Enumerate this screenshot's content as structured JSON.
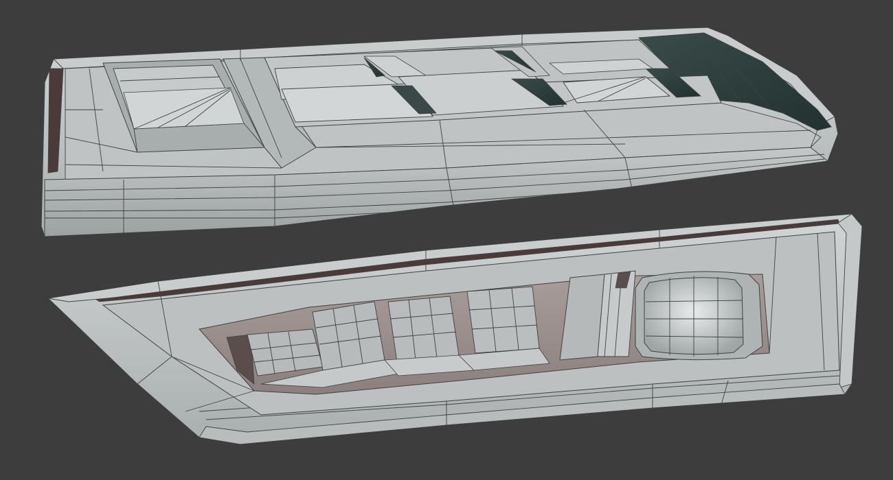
{
  "scene": {
    "background_color": "#3d3d3d",
    "objects": [
      {
        "name": "upper-headlight-housing",
        "view": "top-back"
      },
      {
        "name": "lower-headlight-housing",
        "view": "front-interior"
      }
    ],
    "palette": {
      "shell": "#b9bdbd",
      "shell_light": "#d4d7d7",
      "shell_dark": "#8d9292",
      "interior": "#9d9491",
      "interior_dark": "#5a4d4c",
      "glass": "#2e3d3c",
      "wire": "#3e4142"
    }
  }
}
